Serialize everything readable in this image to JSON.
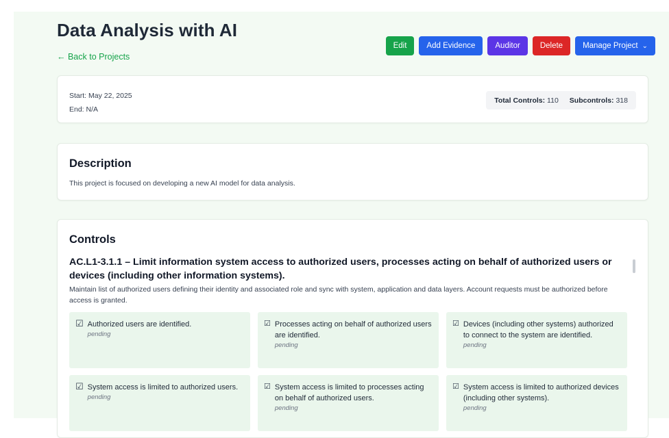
{
  "project": {
    "title": "Data Analysis with AI",
    "back_link": "← Back to Projects"
  },
  "actions": {
    "edit": "Edit",
    "add_evidence": "Add Evidence",
    "auditor": "Auditor",
    "delete": "Delete",
    "manage_project": "Manage Project"
  },
  "colors": {
    "green": "#16a34a",
    "blue": "#2563eb",
    "purple": "#5b35e6",
    "red": "#dc2626",
    "page_bg": "#f3faf3",
    "subcontrol_bg": "#eaf6ec"
  },
  "icons": {
    "back": "arrow-left-icon",
    "manage_project": "chevron-down-icon",
    "checkbox": "checkbox-checked-icon"
  },
  "dates": {
    "start": "Start: May 22, 2025",
    "end": "End: N/A"
  },
  "totals": {
    "controls_label": "Total Controls:",
    "controls_value": "110",
    "subcontrols_label": "Subcontrols:",
    "subcontrols_value": "318"
  },
  "description": {
    "heading": "Description",
    "text": "This project is focused on developing a new AI model for data analysis."
  },
  "controls": {
    "heading": "Controls",
    "items": [
      {
        "title": "AC.L1-3.1.1 – Limit information system access to authorized users, processes acting on behalf of authorized users or devices (including other information systems).",
        "description": "Maintain list of authorized users defining their identity and associated role and sync with system, application and data layers. Account requests must be authorized before access is granted.",
        "subcontrols": [
          {
            "text": "Authorized users are identified.",
            "status": "pending"
          },
          {
            "text": "Processes acting on behalf of authorized users are identified.",
            "status": "pending"
          },
          {
            "text": "Devices (including other systems) authorized to connect to the system are identified.",
            "status": "pending"
          },
          {
            "text": "System access is limited to authorized users.",
            "status": "pending"
          },
          {
            "text": "System access is limited to processes acting on behalf of authorized users.",
            "status": "pending"
          },
          {
            "text": "System access is limited to authorized devices (including other systems).",
            "status": "pending"
          }
        ]
      }
    ]
  }
}
